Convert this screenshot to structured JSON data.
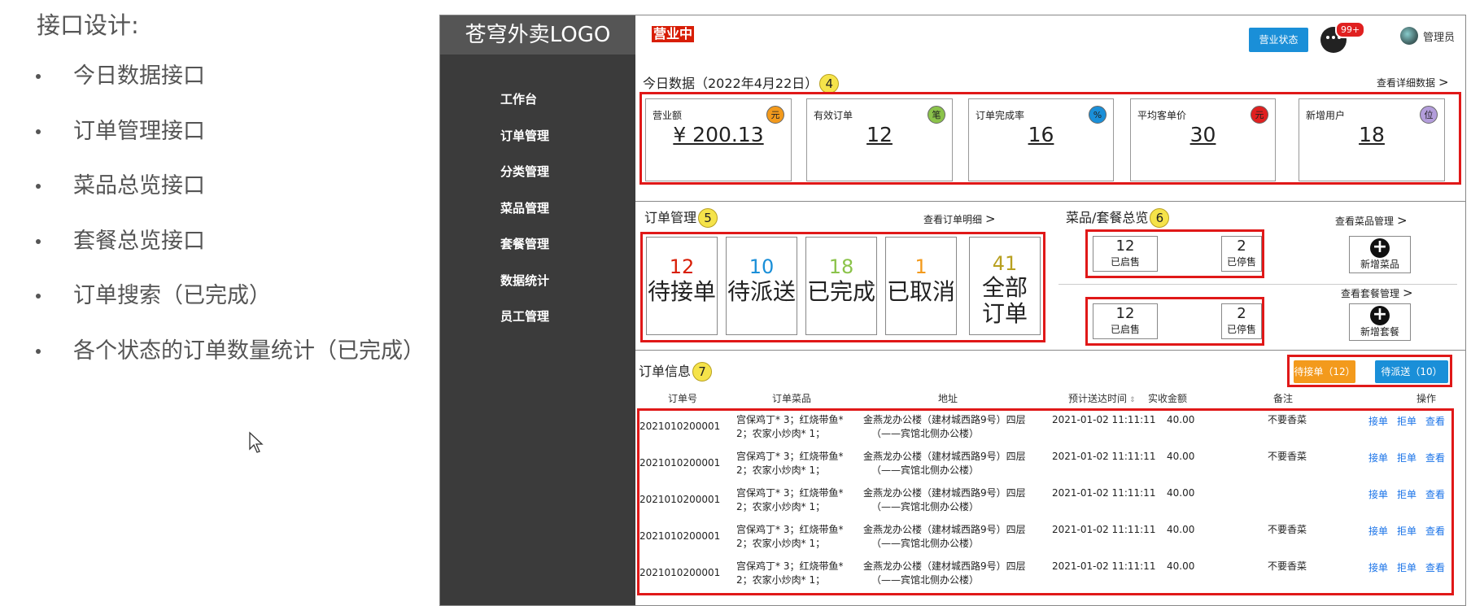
{
  "slide": {
    "title": "接口设计:",
    "bullets": [
      "今日数据接口",
      "订单管理接口",
      "菜品总览接口",
      "套餐总览接口",
      "订单搜索（已完成）",
      "各个状态的订单数量统计（已完成）"
    ]
  },
  "app": {
    "logo": "苍穹外卖LOGO",
    "sidebar": [
      "工作台",
      "订单管理",
      "分类管理",
      "菜品管理",
      "套餐管理",
      "数据统计",
      "员工管理"
    ],
    "header": {
      "open_badge": "营业中",
      "status_button": "营业状态",
      "msg_count": "99+",
      "user": "管理员"
    },
    "today": {
      "title": "今日数据（2022年4月22日）",
      "num": "4",
      "link": "查看详细数据",
      "cards": [
        {
          "label": "营业额",
          "value": "¥ 200.13",
          "icon": "元",
          "color": "#f39a1c"
        },
        {
          "label": "有效订单",
          "value": "12",
          "icon": "笔",
          "color": "#8bc34a"
        },
        {
          "label": "订单完成率",
          "value": "16",
          "icon": "%",
          "color": "#1a8fd8"
        },
        {
          "label": "平均客单价",
          "value": "30",
          "icon": "元",
          "color": "#e02020"
        },
        {
          "label": "新增用户",
          "value": "18",
          "icon": "位",
          "color": "#b39ddb"
        }
      ]
    },
    "orders": {
      "title": "订单管理",
      "num": "5",
      "link": "查看订单明细",
      "items": [
        {
          "count": "12",
          "label": "待接单",
          "color": "#d81e06"
        },
        {
          "count": "10",
          "label": "待派送",
          "color": "#1a8fd8"
        },
        {
          "count": "18",
          "label": "已完成",
          "color": "#8bc34a"
        },
        {
          "count": "1",
          "label": "已取消",
          "color": "#f39a1c"
        },
        {
          "count": "41",
          "label": "全部订单",
          "color": "#b8a020"
        }
      ]
    },
    "overview": {
      "title": "菜品/套餐总览",
      "num": "6",
      "dish_link": "查看菜品管理",
      "combo_link": "查看套餐管理",
      "dish": {
        "on": "12",
        "on_label": "已启售",
        "off": "2",
        "off_label": "已停售",
        "add": "新增菜品"
      },
      "combo": {
        "on": "12",
        "on_label": "已启售",
        "off": "2",
        "off_label": "已停售",
        "add": "新增套餐"
      }
    },
    "info": {
      "title": "订单信息",
      "num": "7",
      "btn_pending": "待接单（12）",
      "btn_deliver": "待派送（10）",
      "headers": [
        "订单号",
        "订单菜品",
        "地址",
        "预计送达时间",
        "实收金额",
        "备注",
        "操作"
      ],
      "rows": [
        {
          "id": "2021010200001",
          "dish1": "宫保鸡丁* 3；红烧带鱼*",
          "dish2": "2；农家小炒肉* 1；",
          "addr1": "金燕龙办公楼（建材城西路9号）四层",
          "addr2": "（——宾馆北侧办公楼）",
          "time": "2021-01-02 11:11:11",
          "amount": "40.00",
          "note": "不要香菜",
          "a1": "接单",
          "a2": "拒单",
          "a3": "查看"
        },
        {
          "id": "2021010200001",
          "dish1": "宫保鸡丁* 3；红烧带鱼*",
          "dish2": "2；农家小炒肉* 1；",
          "addr1": "金燕龙办公楼（建材城西路9号）四层",
          "addr2": "（——宾馆北侧办公楼）",
          "time": "2021-01-02 11:11:11",
          "amount": "40.00",
          "note": "不要香菜",
          "a1": "接单",
          "a2": "拒单",
          "a3": "查看"
        },
        {
          "id": "2021010200001",
          "dish1": "宫保鸡丁* 3；红烧带鱼*",
          "dish2": "2；农家小炒肉* 1；",
          "addr1": "金燕龙办公楼（建材城西路9号）四层",
          "addr2": "（——宾馆北侧办公楼）",
          "time": "2021-01-02 11:11:11",
          "amount": "40.00",
          "note": "",
          "a1": "接单",
          "a2": "拒单",
          "a3": "查看"
        },
        {
          "id": "2021010200001",
          "dish1": "宫保鸡丁* 3；红烧带鱼*",
          "dish2": "2；农家小炒肉* 1；",
          "addr1": "金燕龙办公楼（建材城西路9号）四层",
          "addr2": "（——宾馆北侧办公楼）",
          "time": "2021-01-02 11:11:11",
          "amount": "40.00",
          "note": "不要香菜",
          "a1": "接单",
          "a2": "拒单",
          "a3": "查看"
        },
        {
          "id": "2021010200001",
          "dish1": "宫保鸡丁* 3；红烧带鱼*",
          "dish2": "2；农家小炒肉* 1；",
          "addr1": "金燕龙办公楼（建材城西路9号）四层",
          "addr2": "（——宾馆北侧办公楼）",
          "time": "2021-01-02 11:11:11",
          "amount": "40.00",
          "note": "不要香菜",
          "a1": "接单",
          "a2": "拒单",
          "a3": "查看"
        }
      ]
    }
  }
}
